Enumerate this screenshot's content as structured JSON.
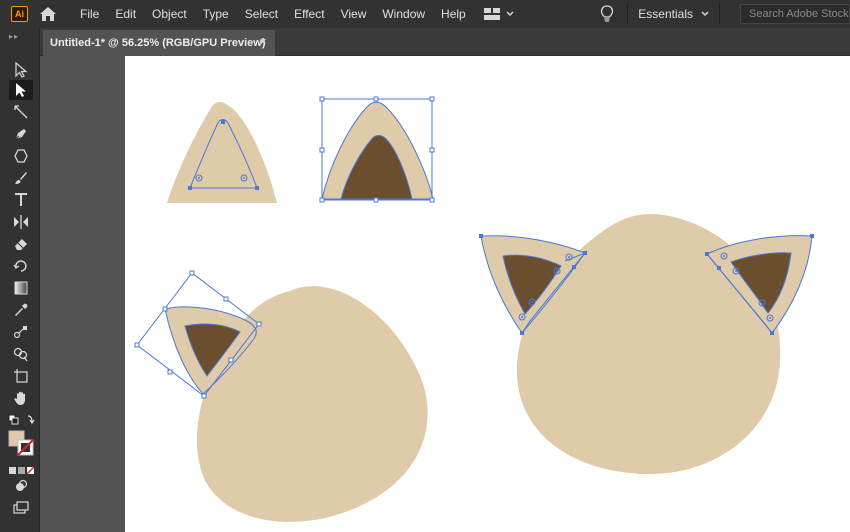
{
  "app": {
    "logo_text": "Ai"
  },
  "menu": {
    "items": [
      "File",
      "Edit",
      "Object",
      "Type",
      "Select",
      "Effect",
      "View",
      "Window",
      "Help"
    ]
  },
  "workspace": {
    "name": "Essentials"
  },
  "search": {
    "placeholder": "Search Adobe Stock"
  },
  "document": {
    "tab_title": "Untitled-1* @ 56.25% (RGB/GPU Preview)",
    "close_glyph": "×"
  },
  "colors": {
    "fill": "#dfcba9",
    "inner": "#6b4e2e",
    "selection": "#4a78d6",
    "ui_dark": "#323232",
    "canvas": "#535353",
    "accent_logo": "#ff9a00"
  },
  "tools": [
    "selection-tool-icon",
    "direct-selection-tool-icon",
    "line-tool-icon",
    "pen-tool-icon",
    "polygon-tool-icon",
    "paintbrush-tool-icon",
    "type-tool-icon",
    "width-tool-icon",
    "eraser-tool-icon",
    "rotate-tool-icon",
    "gradient-tool-icon",
    "eyedropper-tool-icon",
    "blend-tool-icon",
    "shape-builder-tool-icon",
    "artboard-tool-icon",
    "hand-tool-icon",
    "default-colors-icon",
    "fill-swatch",
    "stroke-swatch",
    "color-mode-icon",
    "draw-mode-icon",
    "screen-mode-icon"
  ]
}
